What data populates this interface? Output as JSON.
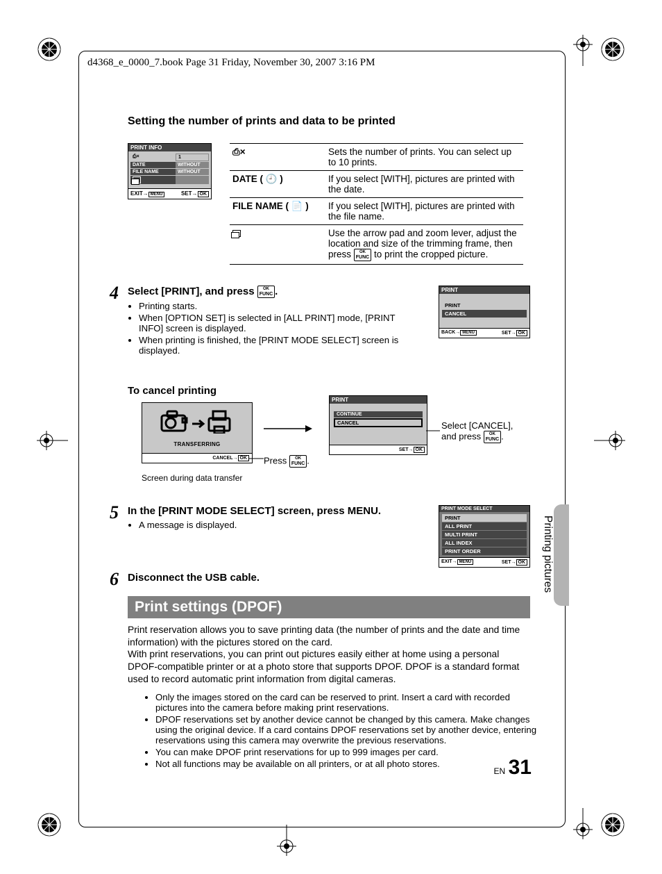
{
  "header": {
    "file_info": "d4368_e_0000_7.book  Page 31  Friday, November 30, 2007  3:16 PM"
  },
  "section_title": "Setting the number of prints and data to be printed",
  "print_info_box": {
    "title": "PRINT INFO",
    "rows": [
      {
        "label": "⎙×",
        "value": "1"
      },
      {
        "label": "DATE",
        "value": "WITHOUT"
      },
      {
        "label": "FILE NAME",
        "value": "WITHOUT"
      }
    ],
    "crop_icon": "crop-icon",
    "foot_left": "EXIT",
    "foot_right": "SET"
  },
  "spec_table": [
    {
      "label": "⎙×",
      "desc": "Sets the number of prints. You can select up to 10 prints."
    },
    {
      "label": "DATE ( 🕘 )",
      "desc": "If you select [WITH], pictures are printed with the date."
    },
    {
      "label": "FILE NAME ( 📄 )",
      "desc": "If you select [WITH], pictures are printed with the file name."
    },
    {
      "label": "crop",
      "desc": "Use the arrow pad and zoom lever, adjust the location and size of the trimming frame, then press   to print the cropped picture.",
      "desc_before_btn": "Use the arrow pad and zoom lever, adjust the location and size of the trimming frame, then press ",
      "desc_after_btn": " to print the cropped picture."
    }
  ],
  "step4": {
    "num": "4",
    "head_before": "Select [PRINT], and press ",
    "head_after": ".",
    "bullets": [
      "Printing starts.",
      "When [OPTION SET] is selected in [ALL PRINT] mode, [PRINT INFO] screen is displayed.",
      "When printing is finished, the [PRINT MODE SELECT] screen is displayed."
    ],
    "screen": {
      "title": "PRINT",
      "items": [
        {
          "label": "PRINT",
          "sel": false
        },
        {
          "label": "CANCEL",
          "sel": true
        }
      ],
      "foot_left": "BACK",
      "foot_right": "SET"
    }
  },
  "cancel_section": {
    "heading": "To cancel printing",
    "transfer_screen": {
      "label": "TRANSFERRING",
      "cancel": "CANCEL"
    },
    "caption": "Screen during data transfer",
    "press_text_before": "Press ",
    "press_text_after": ".",
    "print_screen": {
      "title": "PRINT",
      "items": [
        {
          "label": "CONTINUE",
          "sel": true
        },
        {
          "label": "CANCEL",
          "sel": false,
          "outlined": true
        }
      ],
      "foot_right": "SET"
    },
    "select_text_before": "Select [CANCEL], and press ",
    "select_text_after": "."
  },
  "step5": {
    "num": "5",
    "head": "In the [PRINT MODE SELECT] screen, press MENU.",
    "head_before": "In the [PRINT MODE SELECT] screen, press ",
    "head_menu": "MENU",
    "head_after": ".",
    "bullets": [
      "A message is displayed."
    ],
    "screen": {
      "title": "PRINT MODE SELECT",
      "items": [
        "PRINT",
        "ALL PRINT",
        "MULTI PRINT",
        "ALL INDEX",
        "PRINT ORDER"
      ],
      "selected_index": 0,
      "foot_left": "EXIT",
      "foot_right": "SET"
    }
  },
  "step6": {
    "num": "6",
    "head": "Disconnect the USB cable."
  },
  "dpof": {
    "title": "Print settings (DPOF)",
    "para1": "Print reservation allows you to save printing data (the number of prints and the date and time information) with the pictures stored on the card.",
    "para2": "With print reservations, you can print out pictures easily either at home using a personal DPOF-compatible printer or at a photo store that supports DPOF. DPOF is a standard format used to record automatic print information from digital cameras.",
    "bullets": [
      "Only the images stored on the card can be reserved to print. Insert a card with recorded pictures into the camera before making print reservations.",
      "DPOF reservations set by another device cannot be changed by this camera. Make changes using the original device. If a card contains DPOF reservations set by another device, entering reservations using this camera may overwrite the previous reservations.",
      "You can make DPOF print reservations for up to 999 images per card.",
      "Not all functions may be available on all printers, or at all photo stores."
    ]
  },
  "side_label": "Printing pictures",
  "page": {
    "lang": "EN",
    "num": "31"
  },
  "ok_label": {
    "top": "OK",
    "bot": "FUNC"
  }
}
